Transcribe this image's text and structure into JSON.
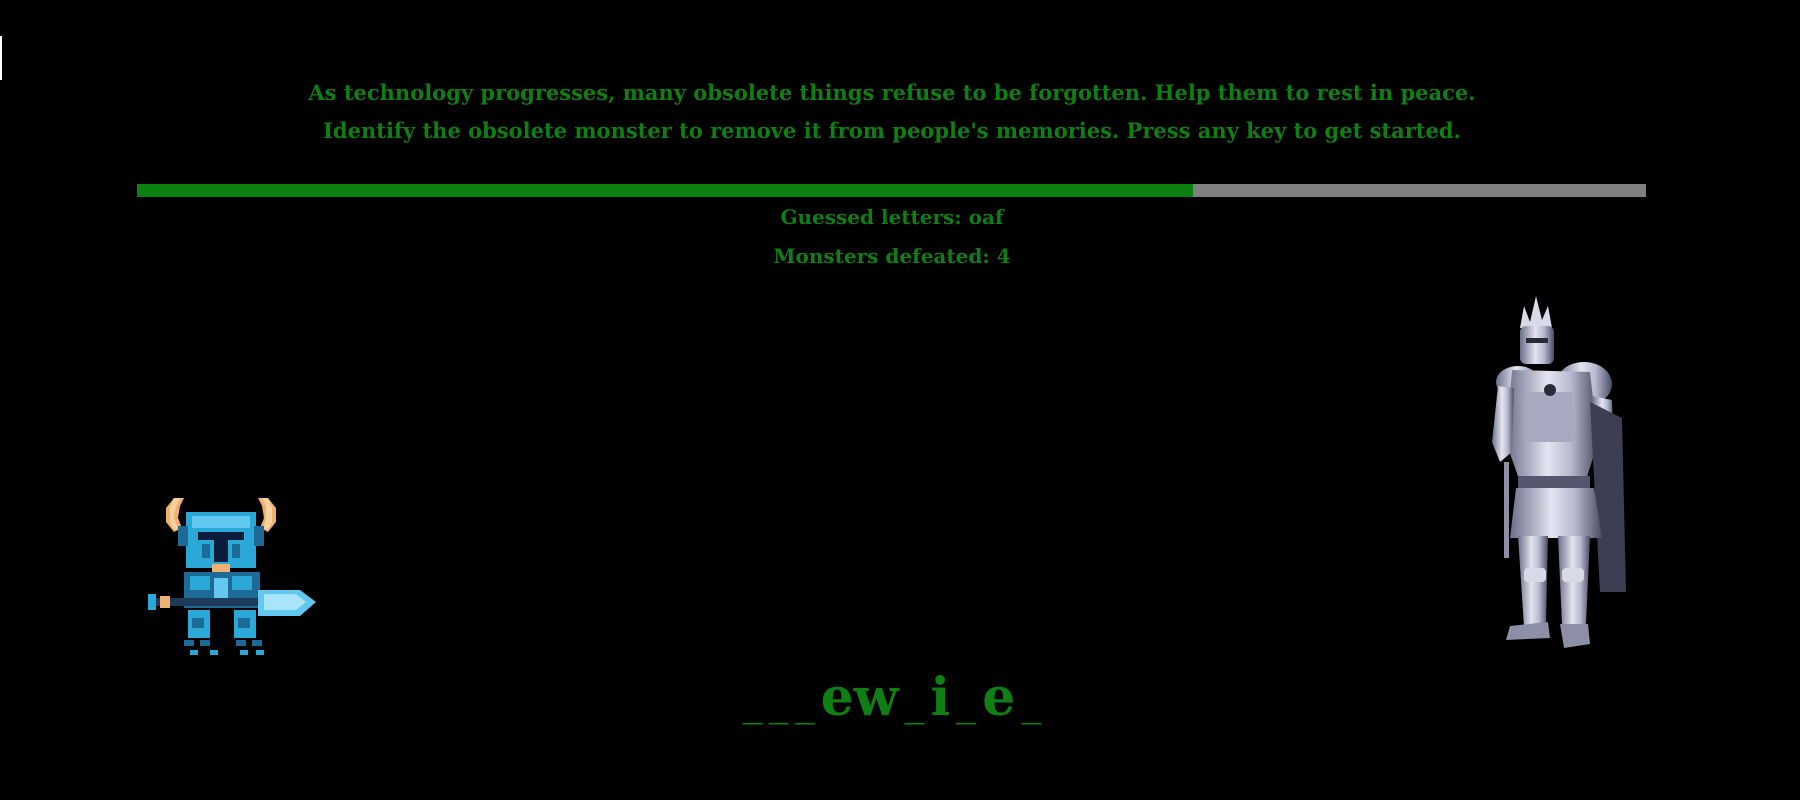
{
  "intro": {
    "line1": "As technology progresses, many obsolete things refuse to be forgotten. Help them to rest in peace.",
    "line2": "Identify the obsolete monster to remove it from people's memories. Press any key to get started."
  },
  "progress": {
    "fraction": 0.7,
    "fill_color": "#0a800e",
    "track_color": "#808080"
  },
  "stats": {
    "guessed_letters": "Guessed letters: oaf",
    "monsters_defeated": "Monsters defeated: 4"
  },
  "word": {
    "chars": [
      "_",
      "_",
      "_",
      "ew",
      "_",
      "i",
      "_",
      "e",
      "_"
    ]
  },
  "sprites": {
    "hero": "shovel-knight-hero-icon",
    "monster": "armored-knight-monster-icon"
  },
  "colors": {
    "text": "#0f7f13",
    "background": "#000000"
  }
}
